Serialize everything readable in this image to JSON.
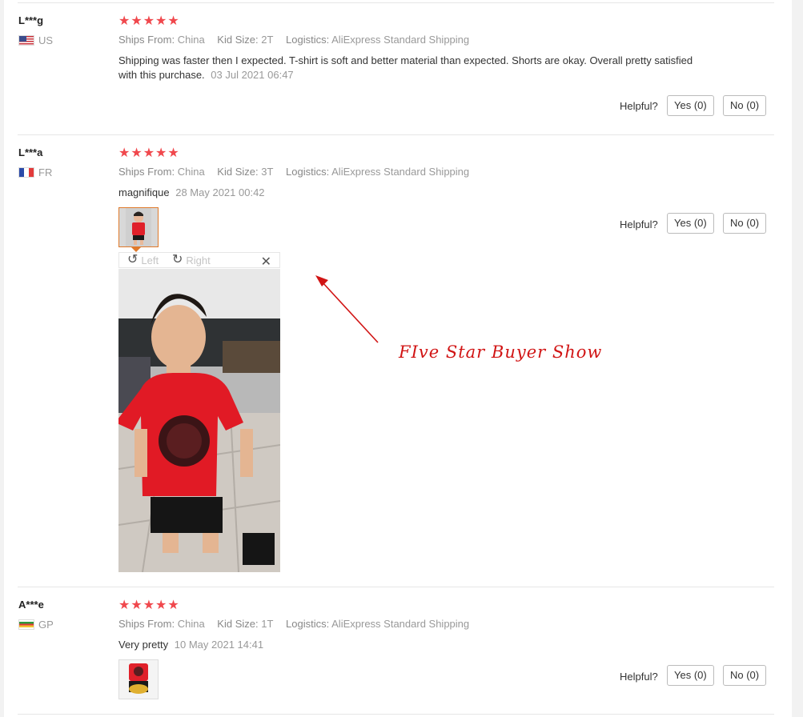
{
  "reviews": [
    {
      "user": "L***g",
      "country": "US",
      "stars_icon": "★★★★★",
      "rating": 5,
      "ships_label": "Ships From:",
      "ships_value": "China",
      "size_label": "Kid Size:",
      "size_value": "2T",
      "logistics_label": "Logistics:",
      "logistics_value": "AliExpress Standard Shipping",
      "text": "Shipping was faster then I expected. T-shirt is soft and better material than expected. Shorts are okay. Overall pretty satisfied with this purchase.",
      "date": "03 Jul 2021 06:47",
      "helpful_label": "Helpful?",
      "yes_label": "Yes (0)",
      "no_label": "No (0)"
    },
    {
      "user": "L***a",
      "country": "FR",
      "stars_icon": "★★★★★",
      "rating": 5,
      "ships_label": "Ships From:",
      "ships_value": "China",
      "size_label": "Kid Size:",
      "size_value": "3T",
      "logistics_label": "Logistics:",
      "logistics_value": "AliExpress Standard Shipping",
      "text": "magnifique",
      "date": "28 May 2021 00:42",
      "helpful_label": "Helpful?",
      "yes_label": "Yes (0)",
      "no_label": "No (0)"
    },
    {
      "user": "A***e",
      "country": "GP",
      "stars_icon": "★★★★★",
      "rating": 5,
      "ships_label": "Ships From:",
      "ships_value": "China",
      "size_label": "Kid Size:",
      "size_value": "1T",
      "logistics_label": "Logistics:",
      "logistics_value": "AliExpress Standard Shipping",
      "text": "Very pretty",
      "date": "10 May 2021 14:41",
      "helpful_label": "Helpful?",
      "yes_label": "Yes (0)",
      "no_label": "No (0)"
    }
  ],
  "viewer": {
    "rotate_left_label": "Left",
    "rotate_right_label": "Right",
    "rotate_left_icon": "↺",
    "rotate_right_icon": "↻",
    "close_icon": "✕"
  },
  "annotation": {
    "text": "FIve Star Buyer Show",
    "color": "#d11414"
  },
  "colors": {
    "star": "#f0484d",
    "thumb_active_border": "#e07a2b"
  }
}
